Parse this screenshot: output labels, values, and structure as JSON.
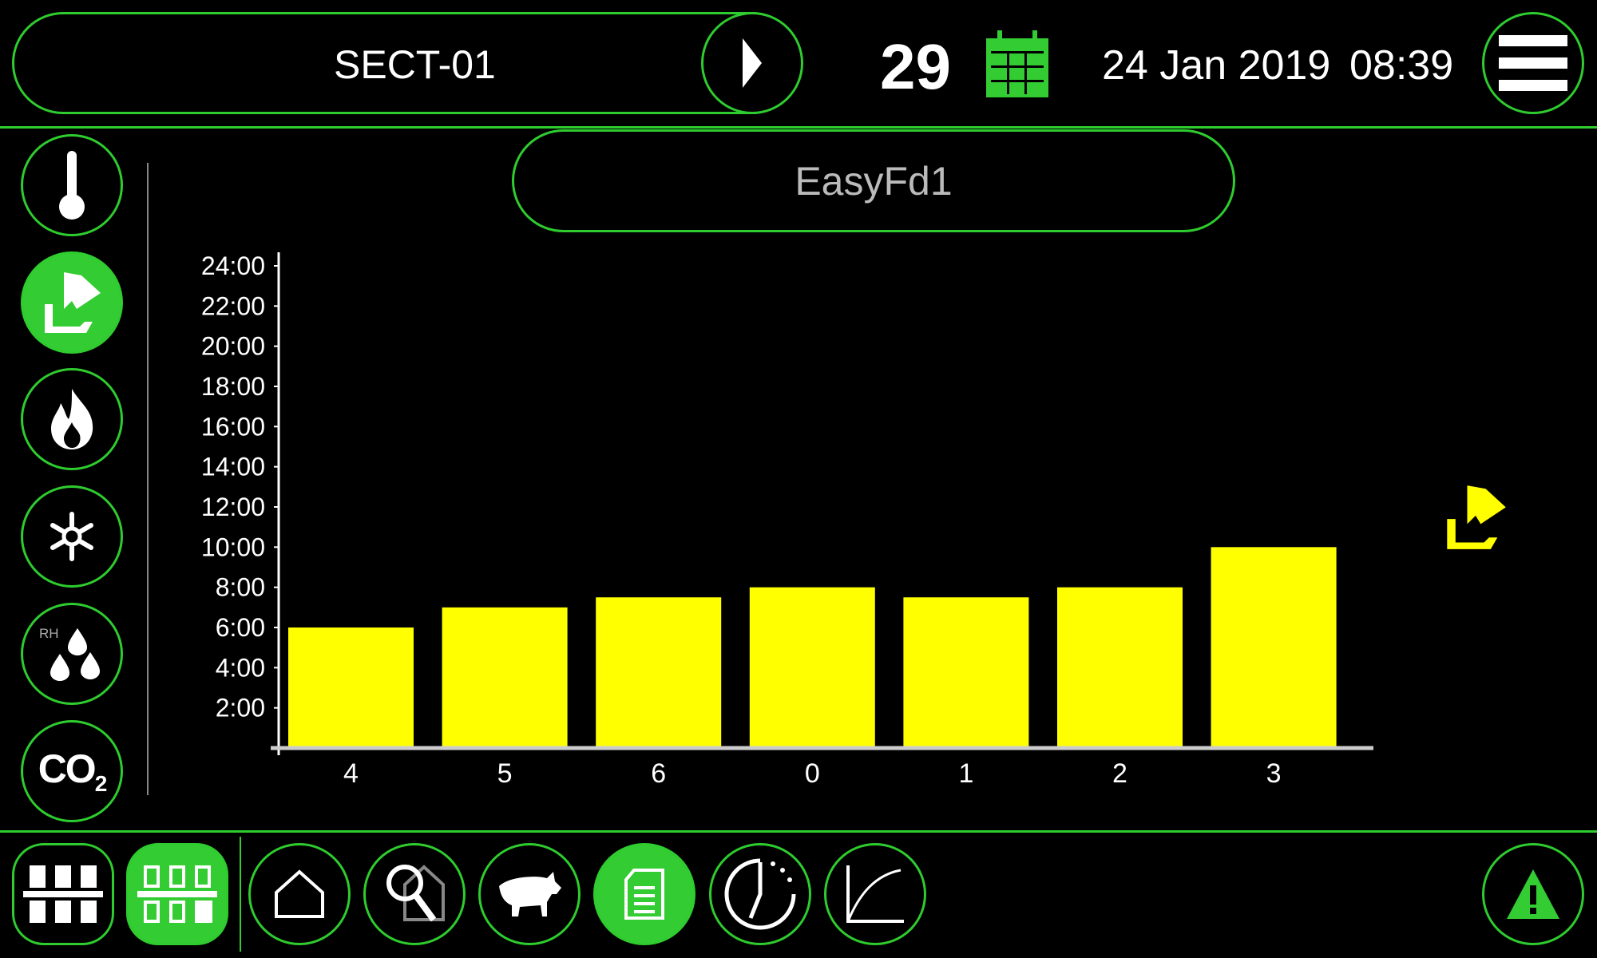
{
  "header": {
    "section_label": "SECT-01",
    "day_number": "29",
    "date": "24 Jan 2019",
    "time": "08:39"
  },
  "title": "EasyFd1",
  "side_icons": [
    "thermometer-icon",
    "feeder-icon",
    "flame-icon",
    "snowflake-icon",
    "humidity-icon",
    "co2-icon"
  ],
  "side_labels": {
    "rh": "RH",
    "co2": "CO",
    "co2_sub": "2"
  },
  "side_active": "feeder-icon",
  "bottom_icons": [
    "sections-grid-icon",
    "sections-grid-outline-icon",
    "home-icon",
    "house-search-icon",
    "pig-icon",
    "document-icon",
    "clock-icon",
    "graph-icon",
    "alarm-warning-icon"
  ],
  "bottom_active": [
    "sections-grid-outline-icon",
    "document-icon"
  ],
  "colors": {
    "accent": "#33cc33",
    "bar": "#ffff00",
    "background": "#000000"
  },
  "chart_data": {
    "type": "bar",
    "categories": [
      "4",
      "5",
      "6",
      "0",
      "1",
      "2",
      "3"
    ],
    "values": [
      "6:00",
      "7:00",
      "7:30",
      "8:00",
      "7:30",
      "8:00",
      "10:00"
    ],
    "yticks": [
      "2:00",
      "4:00",
      "6:00",
      "8:00",
      "10:00",
      "12:00",
      "14:00",
      "16:00",
      "18:00",
      "20:00",
      "22:00",
      "24:00"
    ],
    "ylim": [
      "0:00",
      "24:00"
    ],
    "grid": false
  }
}
